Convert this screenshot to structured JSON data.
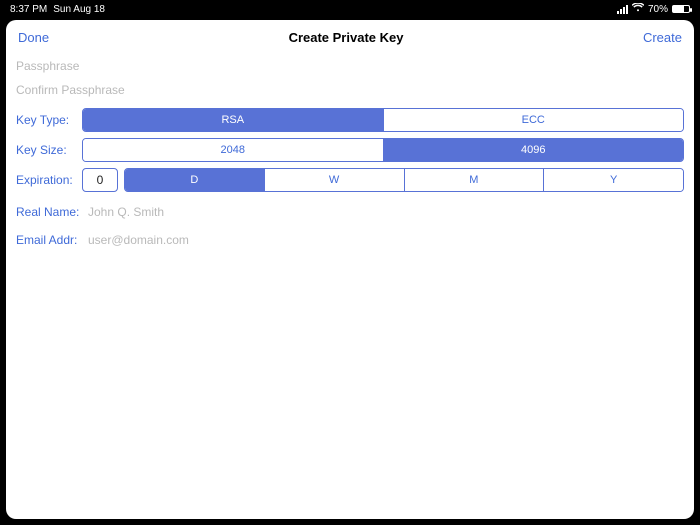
{
  "statusbar": {
    "time": "8:37 PM",
    "date": "Sun Aug 18",
    "battery_pct": "70%"
  },
  "navbar": {
    "done": "Done",
    "title": "Create Private Key",
    "create": "Create"
  },
  "fields": {
    "passphrase_placeholder": "Passphrase",
    "confirm_placeholder": "Confirm Passphrase",
    "keytype_label": "Key Type:",
    "keytype_options": {
      "rsa": "RSA",
      "ecc": "ECC"
    },
    "keysize_label": "Key Size:",
    "keysize_options": {
      "s2048": "2048",
      "s4096": "4096"
    },
    "expiration_label": "Expiration:",
    "expiration_value": "0",
    "expiration_units": {
      "d": "D",
      "w": "W",
      "m": "M",
      "y": "Y"
    },
    "realname_label": "Real Name:",
    "realname_placeholder": "John Q. Smith",
    "email_label": "Email Addr:",
    "email_placeholder": "user@domain.com"
  }
}
